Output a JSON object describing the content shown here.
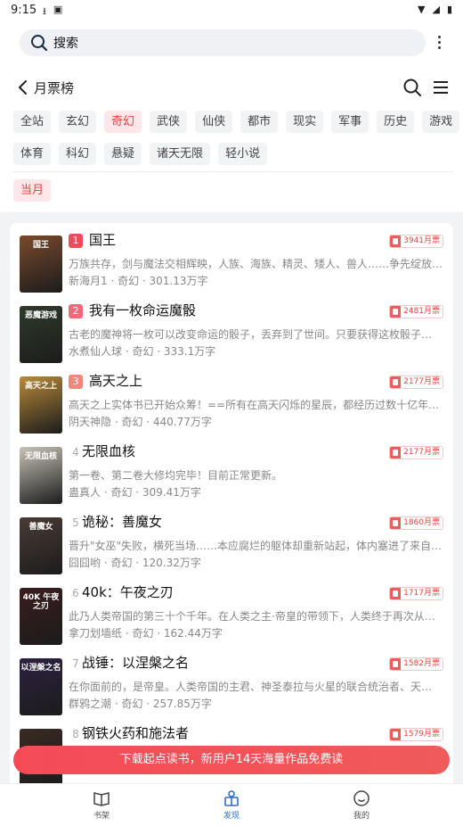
{
  "status": {
    "time": "9:15"
  },
  "search": {
    "label": "搜索"
  },
  "header": {
    "title": "月票榜"
  },
  "categories_row1": [
    "全站",
    "玄幻",
    "奇幻",
    "武侠",
    "仙侠",
    "都市",
    "现实",
    "军事",
    "历史",
    "游戏"
  ],
  "categories_row2": [
    "体育",
    "科幻",
    "悬疑",
    "诸天无限",
    "轻小说"
  ],
  "active_category": "奇幻",
  "period": "当月",
  "books": [
    {
      "rank": "1",
      "title": "国王",
      "votes": "3941月票",
      "desc": "万族共存，剑与魔法交相辉映，人族、海族、精灵、矮人、兽人……争先绽放…",
      "meta": "新海月1 · 奇幻 · 301.13万字",
      "cover_text": "国王",
      "cover_color": "#7a4a2c"
    },
    {
      "rank": "2",
      "title": "我有一枚命运魔骰",
      "votes": "2481月票",
      "desc": "古老的魔神将一枚可以改变命运的骰子，丢弃到了世间。只要获得这枚骰子…",
      "meta": "水煮仙人球 · 奇幻 · 333.1万字",
      "cover_text": "恶魔游戏",
      "cover_color": "#2f3a2a"
    },
    {
      "rank": "3",
      "title": "高天之上",
      "votes": "2177月票",
      "desc": "高天之上实体书已开始众筹！==所有在高天闪烁的星辰，都经历过数十亿年…",
      "meta": "阴天神隐 · 奇幻 · 440.77万字",
      "cover_text": "高天之上",
      "cover_color": "#b98a3a"
    },
    {
      "rank": "4",
      "title": "无限血核",
      "votes": "2177月票",
      "desc": "第一卷、第二卷大修均完毕！目前正常更新。",
      "meta": "蛊真人 · 奇幻 · 309.41万字",
      "cover_text": "无限血核",
      "cover_color": "#c8c3b8"
    },
    {
      "rank": "5",
      "title": "诡秘：善魔女",
      "votes": "1860月票",
      "desc": "晋升\"女巫\"失败，横死当场……本应腐烂的躯体却重新站起，体内塞进了来自…",
      "meta": "囧囧哟 · 奇幻 · 120.32万字",
      "cover_text": "善魔女",
      "cover_color": "#4a3b35"
    },
    {
      "rank": "6",
      "title": "40k：午夜之刃",
      "votes": "1717月票",
      "desc": "此乃人类帝国的第三十个千年。在人类之主·帝皇的带领下，人类终于再次从…",
      "meta": "拿刀划墙纸 · 奇幻 · 162.44万字",
      "cover_text": "40K 午夜之刃",
      "cover_color": "#3a1d1d"
    },
    {
      "rank": "7",
      "title": "战锤：以涅槃之名",
      "votes": "1582月票",
      "desc": "在你面前的，是帝皇。人类帝国的主君、神圣泰拉与火星的联合统治者、天…",
      "meta": "群鸦之潮 · 奇幻 · 257.85万字",
      "cover_text": "以涅槃之名",
      "cover_color": "#2c2140"
    },
    {
      "rank": "8",
      "title": "钢铁火药和施法者",
      "votes": "1579月票",
      "desc": "",
      "meta": "",
      "cover_text": "",
      "cover_color": "#3a2a22"
    }
  ],
  "banner": {
    "text": "下载起点读书，新用户14天海量作品免费读"
  },
  "tabs": [
    "书架",
    "发现",
    "我的"
  ],
  "colors": {
    "accent": "#e8433f",
    "tab_active": "#2b6fd8",
    "rank_1": "#f04a5b",
    "rank_2": "#f06a7a",
    "rank_3": "#f0877a"
  }
}
